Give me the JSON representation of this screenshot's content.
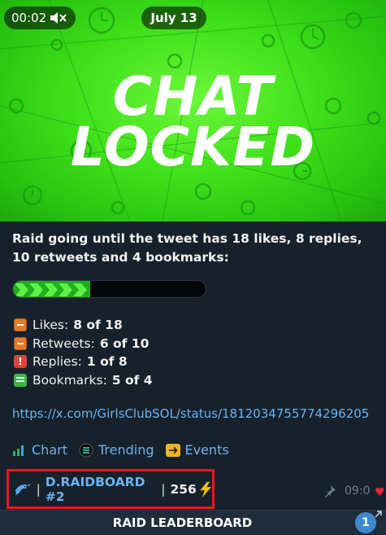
{
  "video": {
    "time": "00:02",
    "date": "July 13",
    "headline_line1": "CHAT",
    "headline_line2": "LOCKED",
    "mute_icon": "speaker-muted-icon"
  },
  "message": {
    "text": "Raid going until the tweet has 18 likes, 8 replies, 10 retweets and 4 bookmarks:",
    "progress": 0.4,
    "stats": [
      {
        "icon": "orange-square-icon",
        "label": "Likes:",
        "value": "8 of 18"
      },
      {
        "icon": "orange-square-icon",
        "label": "Retweets:",
        "value": "6 of 10"
      },
      {
        "icon": "red-exclamation-icon",
        "label": "Replies:",
        "value": "1 of 8"
      },
      {
        "icon": "green-list-icon",
        "label": "Bookmarks:",
        "value": "5 of 4"
      }
    ],
    "link": "https://x.com/GirlsClubSOL/status/1812034755774296205",
    "actions": [
      {
        "icon": "chart-bars-icon",
        "label": "Chart"
      },
      {
        "icon": "trending-coin-icon",
        "label": "Trending"
      },
      {
        "icon": "arrow-right-icon",
        "label": "Events"
      }
    ],
    "leaderboard": {
      "sep1": "|",
      "label": "D.RAIDBOARD #2",
      "sep2": "|",
      "score": "256",
      "icon": "dolphin-icon",
      "bolt_icon": "lightning-icon"
    },
    "time": "09:0",
    "pin_icon": "pin-icon"
  },
  "bottom_bar": {
    "label": "RAID LEADERBOARD",
    "counter": "1"
  },
  "colors": {
    "background": "#17212b",
    "link": "#6ab3f3",
    "highlight_border": "#e01b1b",
    "video_green": "#3fe01a"
  }
}
